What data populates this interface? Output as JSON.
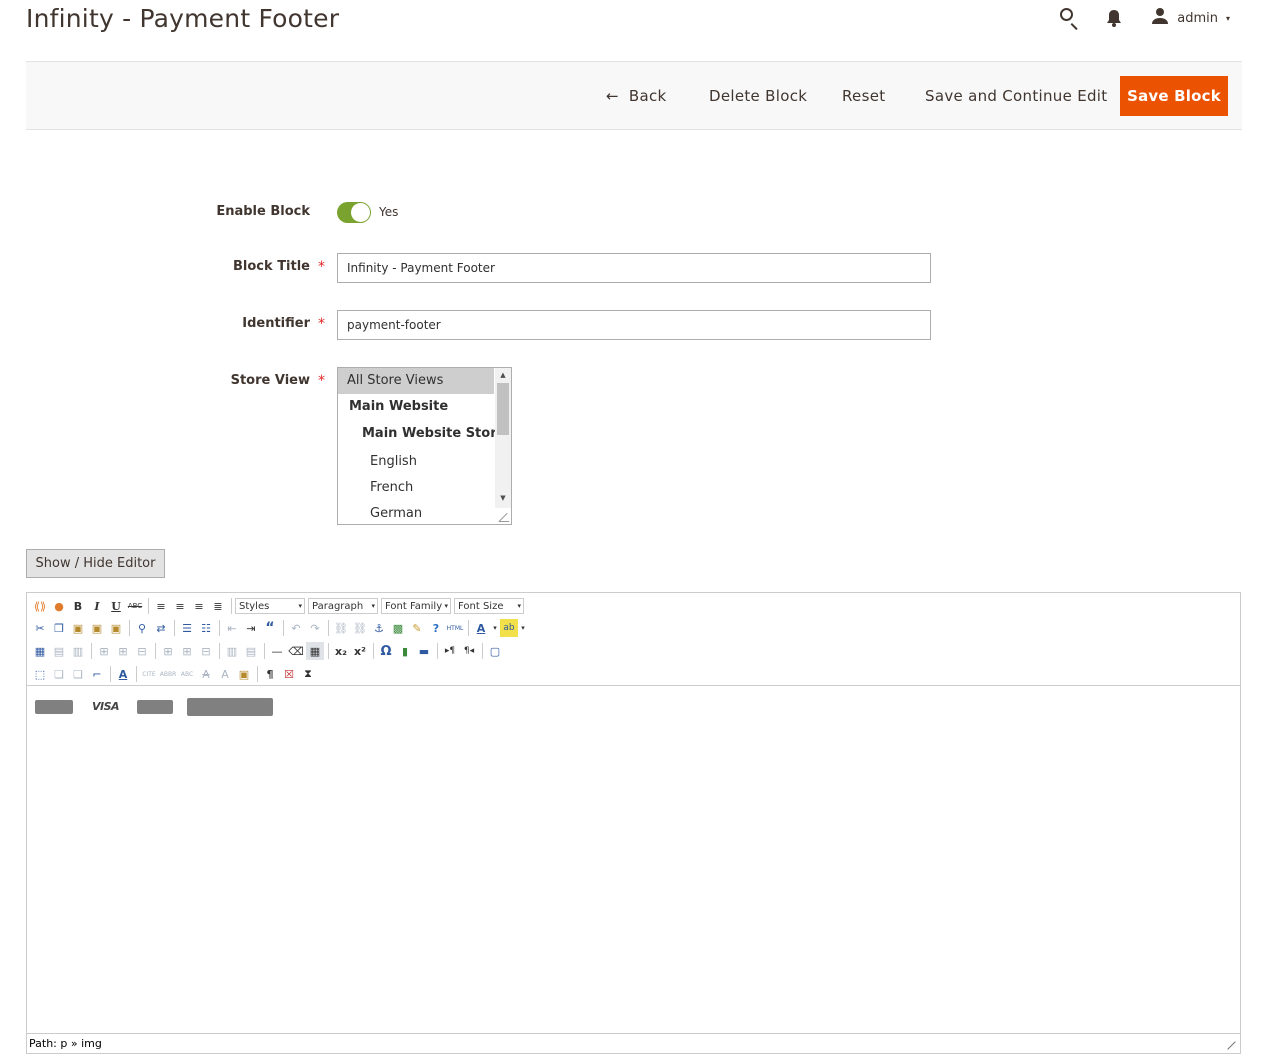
{
  "page": {
    "title": "Infinity - Payment Footer"
  },
  "header": {
    "search_icon": "search-icon",
    "notifications_icon": "bell-icon",
    "user_icon": "user-icon",
    "user_name": "admin",
    "caret": "▾"
  },
  "actions": {
    "back_arrow": "←",
    "back": "Back",
    "delete": "Delete Block",
    "reset": "Reset",
    "save_continue": "Save and Continue Edit",
    "save": "Save Block",
    "save_color": "#eb5202"
  },
  "form": {
    "enable": {
      "label": "Enable Block",
      "value": "Yes",
      "on": true,
      "color": "#79a22e"
    },
    "title": {
      "label": "Block Title",
      "value": "Infinity - Payment Footer"
    },
    "identifier": {
      "label": "Identifier",
      "value": "payment-footer"
    },
    "required_mark": "*",
    "store_view": {
      "label": "Store View",
      "options": [
        {
          "label": "All Store Views",
          "selected": true
        },
        {
          "label": "Main Website"
        },
        {
          "label": "Main Website Store"
        },
        {
          "label": "English"
        },
        {
          "label": "French"
        },
        {
          "label": "German"
        }
      ]
    }
  },
  "editor": {
    "toggle_label": "Show / Hide Editor",
    "selects": {
      "styles": "Styles",
      "paragraph": "Paragraph",
      "font_family": "Font Family",
      "font_size": "Font Size"
    },
    "toolbar_glyphs": {
      "bold": "B",
      "italic": "I",
      "underline": "U",
      "strike": "ABC",
      "subscript": "x₂",
      "superscript": "x²",
      "omega": "Ω",
      "pilcrow": "¶",
      "undo": "↶",
      "redo": "↷",
      "quote": "“",
      "anchor": "⚓",
      "font_color": "A",
      "dropdown": "▾",
      "html": "HTML",
      "hr": "—",
      "help": "?",
      "ltr": "▸¶",
      "rtl": "¶◂",
      "highlight": "ab",
      "styleprops": "A",
      "abbr": "ABBR",
      "cite": "CITE"
    },
    "content_logos": [
      "VISA"
    ],
    "path_label": "Path: p » img"
  }
}
